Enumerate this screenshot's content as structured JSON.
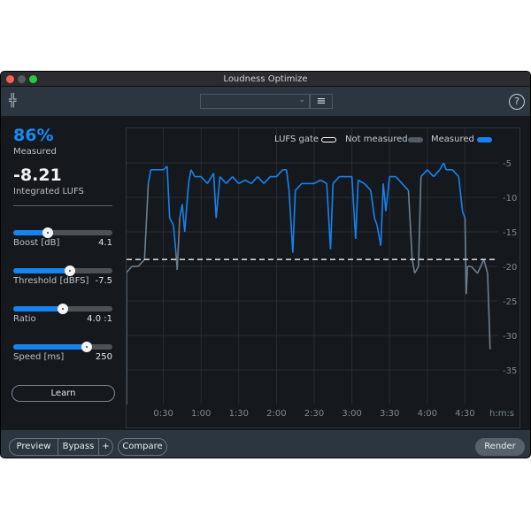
{
  "window": {
    "title": "Loudness Optimize"
  },
  "toolbar": {
    "preset_value": "",
    "menu_icon": "hamburger-icon",
    "help_label": "?",
    "logo_icon": "waveform-logo-icon"
  },
  "stats": {
    "measured_pct": "86%",
    "measured_label": "Measured",
    "integrated": "-8.21",
    "integrated_label": "Integrated LUFS"
  },
  "colors": {
    "accent": "#1683f0",
    "not_measured": "#6e7d8c",
    "background": "#15191e"
  },
  "sliders": [
    {
      "label": "Boost [dB]",
      "value": "4.1",
      "fraction": 0.35
    },
    {
      "label": "Threshold [dBFS]",
      "value": "-7.5",
      "fraction": 0.57
    },
    {
      "label": "Ratio",
      "value": "4.0 :1",
      "fraction": 0.5
    },
    {
      "label": "Speed [ms]",
      "value": "250",
      "fraction": 0.74
    }
  ],
  "learn_label": "Learn",
  "bottom": {
    "preview": "Preview",
    "bypass": "Bypass",
    "plus": "+",
    "compare": "Compare",
    "render": "Render"
  },
  "chart_data": {
    "type": "line",
    "legend": [
      {
        "label": "LUFS gate"
      },
      {
        "label": "Not measured"
      },
      {
        "label": "Measured"
      }
    ],
    "legend_placement": "top-right",
    "xlabel": "h:m:s",
    "xticks": [
      "0:30",
      "1:00",
      "1:30",
      "2:00",
      "2:30",
      "3:00",
      "3:30",
      "4:00",
      "4:30"
    ],
    "xtick_values": [
      30,
      60,
      90,
      120,
      150,
      180,
      210,
      240,
      270
    ],
    "yticks": [
      -5,
      -10,
      -15,
      -20,
      -25,
      -30,
      -35
    ],
    "ylim": [
      -42,
      1
    ],
    "xlim": [
      0,
      300
    ],
    "gate": -19,
    "grid": true,
    "x": [
      0,
      5,
      10,
      15,
      18,
      20,
      25,
      30,
      33,
      35,
      38,
      40,
      41,
      43,
      45,
      47,
      50,
      52,
      55,
      60,
      65,
      70,
      72,
      75,
      80,
      85,
      90,
      95,
      100,
      105,
      110,
      115,
      120,
      125,
      128,
      130,
      133,
      135,
      140,
      145,
      150,
      155,
      160,
      163,
      165,
      170,
      180,
      183,
      185,
      190,
      195,
      198,
      200,
      203,
      205,
      207,
      210,
      215,
      220,
      225,
      228,
      230,
      233,
      235,
      240,
      245,
      250,
      253,
      255,
      260,
      265,
      268,
      270,
      271,
      272,
      275,
      280,
      285,
      288,
      290
    ],
    "y": [
      -21,
      -20,
      -20,
      -19,
      -8,
      -6,
      -6,
      -6,
      -5.5,
      -13,
      -14,
      -18,
      -20.5,
      -13,
      -11,
      -15,
      -8,
      -6,
      -7,
      -7,
      -8,
      -6.5,
      -13,
      -7,
      -8,
      -7,
      -8,
      -7.5,
      -8,
      -7,
      -8,
      -7,
      -7,
      -6,
      -6,
      -9,
      -18,
      -9,
      -8,
      -8,
      -8,
      -7.5,
      -8,
      -17.5,
      -8,
      -7,
      -7,
      -16,
      -7.5,
      -8,
      -9,
      -13,
      -14,
      -17,
      -8,
      -12,
      -7,
      -7,
      -8,
      -9,
      -19,
      -21,
      -20,
      -7,
      -6,
      -7,
      -6,
      -5,
      -6,
      -6,
      -7,
      -12,
      -13,
      -24,
      -20,
      -20,
      -21,
      -19,
      -21,
      -32
    ]
  }
}
